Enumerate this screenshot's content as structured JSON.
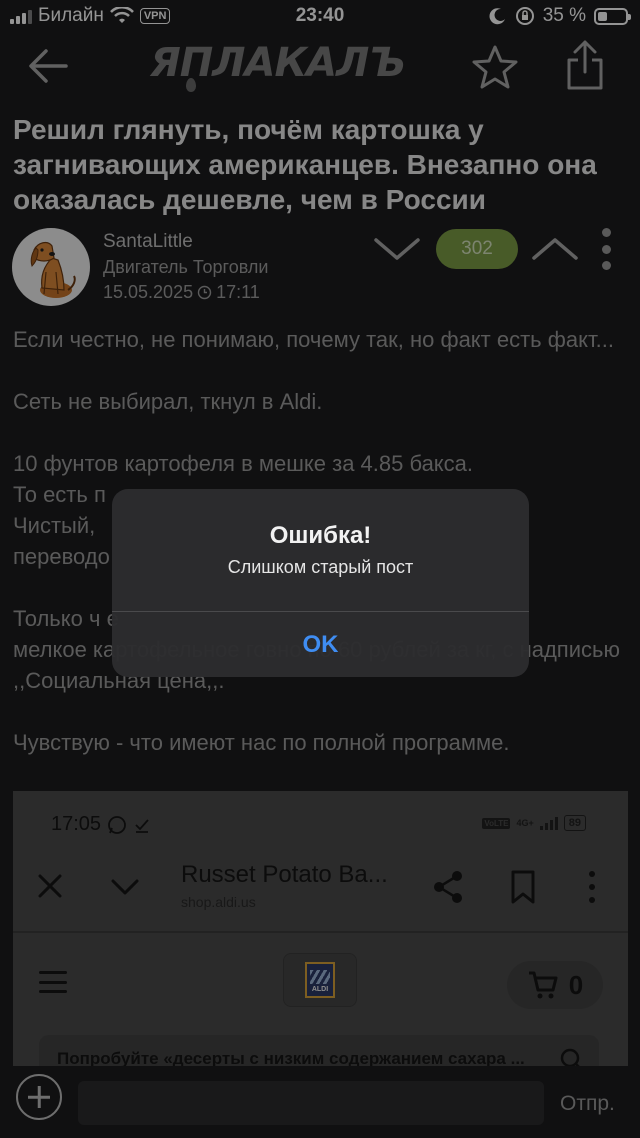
{
  "status_bar": {
    "carrier": "Билайн",
    "vpn": "VPN",
    "time": "23:40",
    "battery_text": "35 %",
    "battery_level": 0.35
  },
  "nav": {
    "logo": "ЯПЛАКАЛЪ"
  },
  "post": {
    "title": "Решил глянуть, почём картошка у загнивающих американцев. Внезапно она оказалась дешевле, чем в России",
    "author": {
      "name": "SantaLittle",
      "role": "Двигатель Торговли",
      "date": "15.05.2025",
      "time": "17:11"
    },
    "rating": "302",
    "body": [
      "Если честно, не понимаю, почему так, но факт есть факт...",
      "Сеть не выбирал, ткнул в Aldi.",
      "10 фунтов картофеля в мешке за 4.85 бакса.\nТо есть п\nЧистый,\nпереводо",
      "Только ч                                                  е\nмелкое картофельное говно по 60 рублей за кг, с надписью ,,Социальная цена,,.",
      "Чувствую - что имеют нас по полной программе."
    ]
  },
  "screenshot": {
    "time": "17:05",
    "lte": "VoLTE",
    "network": "4G+",
    "battery": "89",
    "page_title": "Russet Potato Ba...",
    "page_url": "shop.aldi.us",
    "aldi_word": "ALDI",
    "cart_count": "0",
    "search_text": "Попробуйте «десерты с низким содержанием сахара ..."
  },
  "comment_bar": {
    "placeholder": "",
    "send_label": "Отпр."
  },
  "alert": {
    "title": "Ошибка!",
    "message": "Слишком старый пост",
    "ok_label": "OK"
  },
  "colors": {
    "background": "#1c1c1e",
    "rating_bg": "#7d9d45",
    "alert_button": "#3f8df2"
  }
}
